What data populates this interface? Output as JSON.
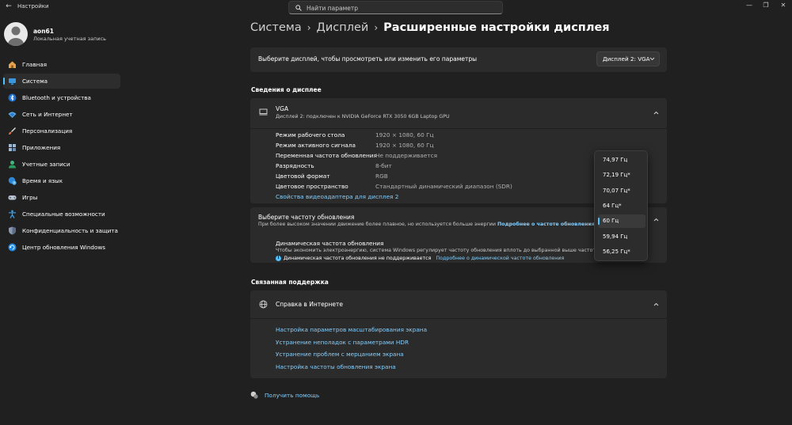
{
  "app": {
    "title": "Настройки"
  },
  "search": {
    "placeholder": "Найти параметр"
  },
  "user": {
    "name": "aon61",
    "account_type": "Локальная учетная запись"
  },
  "nav": [
    {
      "label": "Главная",
      "icon": "home-icon"
    },
    {
      "label": "Система",
      "icon": "system-icon",
      "active": true
    },
    {
      "label": "Bluetooth и устройства",
      "icon": "bluetooth-icon"
    },
    {
      "label": "Сеть и Интернет",
      "icon": "wifi-icon"
    },
    {
      "label": "Персонализация",
      "icon": "brush-icon"
    },
    {
      "label": "Приложения",
      "icon": "apps-icon"
    },
    {
      "label": "Учетные записи",
      "icon": "person-icon"
    },
    {
      "label": "Время и язык",
      "icon": "globe-clock-icon"
    },
    {
      "label": "Игры",
      "icon": "gamepad-icon"
    },
    {
      "label": "Специальные возможности",
      "icon": "accessibility-icon"
    },
    {
      "label": "Конфиденциальность и защита",
      "icon": "shield-icon"
    },
    {
      "label": "Центр обновления Windows",
      "icon": "update-icon"
    }
  ],
  "breadcrumb": {
    "seg1": "Система",
    "seg2": "Дисплей",
    "current": "Расширенные настройки дисплея"
  },
  "display_select": {
    "label": "Выберите дисплей, чтобы просмотреть или изменить его параметры",
    "value": "Дисплей 2: VGA"
  },
  "display_info": {
    "section_title": "Сведения о дисплее",
    "name": "VGA",
    "subtitle": "Дисплей 2: подключен к NVIDIA GeForce RTX 3050 6GB Laptop GPU",
    "rows": [
      {
        "label": "Режим рабочего стола",
        "value": "1920 × 1080, 60 Гц"
      },
      {
        "label": "Режим активного сигнала",
        "value": "1920 × 1080, 60 Гц"
      },
      {
        "label": "Переменная частота обновления",
        "value": "Не поддерживается"
      },
      {
        "label": "Разрядность",
        "value": "8-бит"
      },
      {
        "label": "Цветовой формат",
        "value": "RGB"
      },
      {
        "label": "Цветовое пространство",
        "value": "Стандартный динамический диапазон (SDR)"
      }
    ],
    "adapter_link": "Свойства видеоадаптера для дисплея 2"
  },
  "refresh": {
    "title": "Выберите частоту обновления",
    "subtitle": "При более высоком значении движение более плавное, но используется больше энергии",
    "subtitle_link": "Подробнее о частоте обновления",
    "dynamic_title": "Динамическая частота обновления",
    "dynamic_sub": "Чтобы экономить электроэнергию, система Windows регулирует частоту обновления вплоть до выбранной выше частоты.",
    "dynamic_status": "Динамическая частота обновления не поддерживается",
    "dynamic_link": "Подробнее о динамической частоте обновления",
    "options": [
      "74,97 Гц",
      "72,19 Гц*",
      "70,07 Гц*",
      "64 Гц*",
      "60 Гц",
      "59,94 Гц",
      "56,25 Гц*"
    ],
    "selected_index": 4
  },
  "support": {
    "section_title": "Связанная поддержка",
    "title": "Справка в Интернете",
    "links": [
      "Настройка параметров масштабирования экрана",
      "Устранение неполадок с параметрами HDR",
      "Устранение проблем с мерцанием экрана",
      "Настройка частоты обновления экрана"
    ]
  },
  "get_help": "Получить помощь",
  "colors": {
    "accent": "#4cc2ff",
    "link": "#87cefa",
    "background": "#202020",
    "card": "#2b2b2b"
  }
}
